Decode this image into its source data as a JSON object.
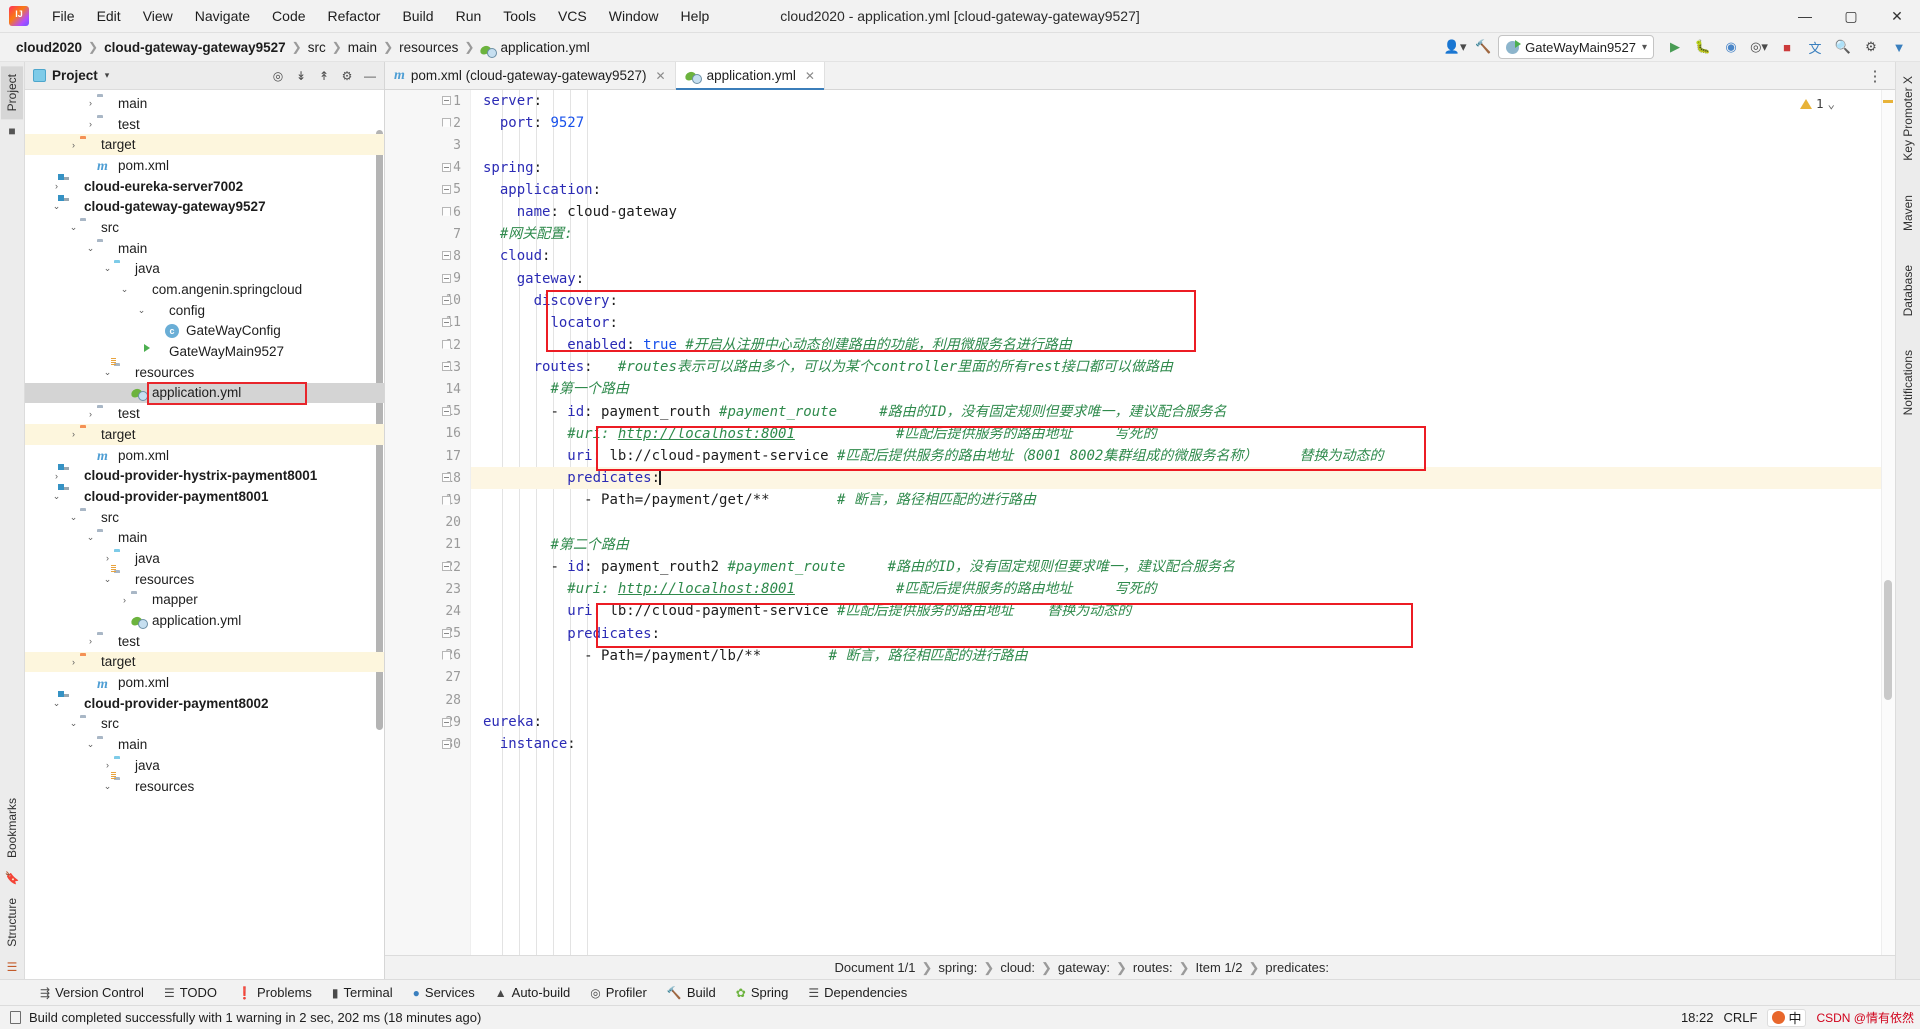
{
  "titlebar": {
    "logo_icon": "intellij-idea-logo",
    "menus": [
      "File",
      "Edit",
      "View",
      "Navigate",
      "Code",
      "Refactor",
      "Build",
      "Run",
      "Tools",
      "VCS",
      "Window",
      "Help"
    ],
    "window_title": "cloud2020 - application.yml [cloud-gateway-gateway9527]",
    "minimize": "—",
    "maximize": "▢",
    "close": "✕"
  },
  "navbar": {
    "crumbs": [
      {
        "label": "cloud2020",
        "bold": true
      },
      {
        "label": "cloud-gateway-gateway9527",
        "bold": true
      },
      {
        "label": "src",
        "bold": false
      },
      {
        "label": "main",
        "bold": false
      },
      {
        "label": "resources",
        "bold": false
      },
      {
        "label": "application.yml",
        "bold": false,
        "icon": "yml-file-icon"
      }
    ],
    "separator": "❯",
    "run_config": "GateWayMain9527",
    "run_config_caret": "▾",
    "icons": [
      "user-avatar-icon",
      "hammer-build-icon",
      "run-icon",
      "debug-icon",
      "coverage-icon",
      "profiler-icon",
      "stop-icon",
      "translate-icon",
      "search-icon",
      "settings-gear-icon",
      "updates-icon"
    ]
  },
  "left_rail": {
    "tabs": [
      "Project"
    ],
    "bottom_tabs": [
      "Bookmarks",
      "Structure"
    ]
  },
  "right_rail": {
    "tabs": [
      "Key Promoter X",
      "Maven",
      "Database",
      "Notifications"
    ]
  },
  "project_panel": {
    "title": "Project",
    "caret": "▾",
    "header_icons": [
      "locate-file-icon",
      "expand-all-icon",
      "collapse-all-icon",
      "settings-gear-icon",
      "hide-icon"
    ],
    "tree": [
      {
        "depth": 3,
        "arrow": "›",
        "icon": "folder-icon",
        "label": "main",
        "bold": false,
        "hl": ""
      },
      {
        "depth": 3,
        "arrow": "›",
        "icon": "folder-icon",
        "label": "test",
        "bold": false,
        "hl": ""
      },
      {
        "depth": 2,
        "arrow": "›",
        "icon": "folder-orange-icon",
        "label": "target",
        "bold": false,
        "hl": "yellow"
      },
      {
        "depth": 3,
        "arrow": "",
        "icon": "maven-pom-icon",
        "label": "pom.xml",
        "bold": false,
        "hl": ""
      },
      {
        "depth": 1,
        "arrow": "›",
        "icon": "module-icon",
        "label": "cloud-eureka-server7002",
        "bold": true,
        "hl": ""
      },
      {
        "depth": 1,
        "arrow": "⌄",
        "icon": "module-icon",
        "label": "cloud-gateway-gateway9527",
        "bold": true,
        "hl": ""
      },
      {
        "depth": 2,
        "arrow": "⌄",
        "icon": "folder-icon",
        "label": "src",
        "bold": false,
        "hl": ""
      },
      {
        "depth": 3,
        "arrow": "⌄",
        "icon": "folder-icon",
        "label": "main",
        "bold": false,
        "hl": ""
      },
      {
        "depth": 4,
        "arrow": "⌄",
        "icon": "folder-blue-icon",
        "label": "java",
        "bold": false,
        "hl": ""
      },
      {
        "depth": 5,
        "arrow": "⌄",
        "icon": "package-icon",
        "label": "com.angenin.springcloud",
        "bold": false,
        "hl": ""
      },
      {
        "depth": 6,
        "arrow": "⌄",
        "icon": "package-icon",
        "label": "config",
        "bold": false,
        "hl": ""
      },
      {
        "depth": 7,
        "arrow": "",
        "icon": "java-class-icon",
        "label": "GateWayConfig",
        "bold": false,
        "hl": ""
      },
      {
        "depth": 6,
        "arrow": "",
        "icon": "spring-main-class-icon",
        "label": "GateWayMain9527",
        "bold": false,
        "hl": ""
      },
      {
        "depth": 4,
        "arrow": "⌄",
        "icon": "resources-folder-icon",
        "label": "resources",
        "bold": false,
        "hl": ""
      },
      {
        "depth": 5,
        "arrow": "",
        "icon": "yml-file-icon",
        "label": "application.yml",
        "bold": false,
        "hl": "grey",
        "outlined": true
      },
      {
        "depth": 3,
        "arrow": "›",
        "icon": "folder-icon",
        "label": "test",
        "bold": false,
        "hl": ""
      },
      {
        "depth": 2,
        "arrow": "›",
        "icon": "folder-orange-icon",
        "label": "target",
        "bold": false,
        "hl": "yellow"
      },
      {
        "depth": 3,
        "arrow": "",
        "icon": "maven-pom-icon",
        "label": "pom.xml",
        "bold": false,
        "hl": ""
      },
      {
        "depth": 1,
        "arrow": "›",
        "icon": "module-icon",
        "label": "cloud-provider-hystrix-payment8001",
        "bold": true,
        "hl": ""
      },
      {
        "depth": 1,
        "arrow": "⌄",
        "icon": "module-icon",
        "label": "cloud-provider-payment8001",
        "bold": true,
        "hl": ""
      },
      {
        "depth": 2,
        "arrow": "⌄",
        "icon": "folder-icon",
        "label": "src",
        "bold": false,
        "hl": ""
      },
      {
        "depth": 3,
        "arrow": "⌄",
        "icon": "folder-icon",
        "label": "main",
        "bold": false,
        "hl": ""
      },
      {
        "depth": 4,
        "arrow": "›",
        "icon": "folder-blue-icon",
        "label": "java",
        "bold": false,
        "hl": ""
      },
      {
        "depth": 4,
        "arrow": "⌄",
        "icon": "resources-folder-icon",
        "label": "resources",
        "bold": false,
        "hl": ""
      },
      {
        "depth": 5,
        "arrow": "›",
        "icon": "folder-icon",
        "label": "mapper",
        "bold": false,
        "hl": ""
      },
      {
        "depth": 5,
        "arrow": "",
        "icon": "yml-file-icon",
        "label": "application.yml",
        "bold": false,
        "hl": ""
      },
      {
        "depth": 3,
        "arrow": "›",
        "icon": "folder-icon",
        "label": "test",
        "bold": false,
        "hl": ""
      },
      {
        "depth": 2,
        "arrow": "›",
        "icon": "folder-orange-icon",
        "label": "target",
        "bold": false,
        "hl": "yellow"
      },
      {
        "depth": 3,
        "arrow": "",
        "icon": "maven-pom-icon",
        "label": "pom.xml",
        "bold": false,
        "hl": ""
      },
      {
        "depth": 1,
        "arrow": "⌄",
        "icon": "module-icon",
        "label": "cloud-provider-payment8002",
        "bold": true,
        "hl": ""
      },
      {
        "depth": 2,
        "arrow": "⌄",
        "icon": "folder-icon",
        "label": "src",
        "bold": false,
        "hl": ""
      },
      {
        "depth": 3,
        "arrow": "⌄",
        "icon": "folder-icon",
        "label": "main",
        "bold": false,
        "hl": ""
      },
      {
        "depth": 4,
        "arrow": "›",
        "icon": "folder-blue-icon",
        "label": "java",
        "bold": false,
        "hl": ""
      },
      {
        "depth": 4,
        "arrow": "⌄",
        "icon": "resources-folder-icon",
        "label": "resources",
        "bold": false,
        "hl": ""
      }
    ]
  },
  "editor": {
    "tabs": [
      {
        "label": "pom.xml (cloud-gateway-gateway9527)",
        "icon": "maven-pom-icon",
        "active": false,
        "close": "✕"
      },
      {
        "label": "application.yml",
        "icon": "yml-file-icon",
        "active": true,
        "close": "✕"
      }
    ],
    "warning_count": "1",
    "warning_icon": "warning-triangle-icon",
    "inspection_caret": "⌄",
    "more_icon": "⋮",
    "lines": [
      {
        "n": 1,
        "fold": "open",
        "html": "<span class='k'>server</span><span class='s'>:</span>"
      },
      {
        "n": 2,
        "fold": "end",
        "html": "  <span class='k'>port</span><span class='s'>: </span><span class='n'>9527</span>"
      },
      {
        "n": 3,
        "fold": "",
        "html": ""
      },
      {
        "n": 4,
        "fold": "open",
        "html": "<span class='k'>spring</span><span class='s'>:</span>"
      },
      {
        "n": 5,
        "fold": "open",
        "html": "  <span class='k'>application</span><span class='s'>:</span>"
      },
      {
        "n": 6,
        "fold": "end",
        "html": "    <span class='k'>name</span><span class='s'>: cloud-gateway</span>"
      },
      {
        "n": 7,
        "fold": "",
        "html": "  <span class='cm'>#网关配置:</span>"
      },
      {
        "n": 8,
        "fold": "open",
        "html": "  <span class='k'>cloud</span><span class='s'>:</span>"
      },
      {
        "n": 9,
        "fold": "open",
        "html": "    <span class='k'>gateway</span><span class='s'>:</span>"
      },
      {
        "n": 10,
        "fold": "open",
        "html": "      <span class='k'>discovery</span><span class='s'>:</span>"
      },
      {
        "n": 11,
        "fold": "open",
        "html": "        <span class='k'>locator</span><span class='s'>:</span>"
      },
      {
        "n": 12,
        "fold": "end",
        "html": "          <span class='k'>enabled</span><span class='s'>: </span><span class='n'>true</span> <span class='cm'>#开启从注册中心动态创建路由的功能，利用微服务名进行路由</span>"
      },
      {
        "n": 13,
        "fold": "open",
        "html": "      <span class='k'>routes</span><span class='s'>:</span>   <span class='cm'>#routes表示可以路由多个，可以为某个controller里面的所有rest接口都可以做路由</span>"
      },
      {
        "n": 14,
        "fold": "",
        "html": "        <span class='cm'>#第一个路由</span>"
      },
      {
        "n": 15,
        "fold": "open",
        "html": "        <span class='s'>- </span><span class='k'>id</span><span class='s'>: payment_routh </span><span class='cm'>#payment_route</span>     <span class='cm'>#路由的ID，没有固定规则但要求唯一，建议配合服务名</span>"
      },
      {
        "n": 16,
        "fold": "",
        "html": "          <span class='cm'>#uri: </span><span class='cmlink'>http://localhost:8001</span>            <span class='cm'>#匹配后提供服务的路由地址     写死的</span>"
      },
      {
        "n": 17,
        "fold": "",
        "html": "          <span class='k'>uri</span><span class='s'>: lb://cloud-payment-service</span> <span class='cm'>#匹配后提供服务的路由地址（8001 8002集群组成的微服务名称）     替换为动态的</span>"
      },
      {
        "n": 18,
        "fold": "open",
        "cur": true,
        "html": "          <span class='k'>predicates</span><span class='s'>:</span><span class='caret'></span>"
      },
      {
        "n": 19,
        "fold": "end",
        "html": "            <span class='s'>- Path=/payment/get/**</span>        <span class='cm'># 断言，路径相匹配的进行路由</span>"
      },
      {
        "n": 20,
        "fold": "",
        "html": ""
      },
      {
        "n": 21,
        "fold": "",
        "html": "        <span class='cm'>#第二个路由</span>"
      },
      {
        "n": 22,
        "fold": "open",
        "html": "        <span class='s'>- </span><span class='k'>id</span><span class='s'>: payment_routh2 </span><span class='cm'>#payment_route</span>     <span class='cm'>#路由的ID，没有固定规则但要求唯一，建议配合服务名</span>"
      },
      {
        "n": 23,
        "fold": "",
        "html": "          <span class='cm'>#uri: </span><span class='cmlink'>http://localhost:8001</span>            <span class='cm'>#匹配后提供服务的路由地址     写死的</span>"
      },
      {
        "n": 24,
        "fold": "",
        "html": "          <span class='k'>uri</span><span class='s'>: lb://cloud-payment-service</span> <span class='cm'>#匹配后提供服务的路由地址    替换为动态的</span>"
      },
      {
        "n": 25,
        "fold": "open",
        "html": "          <span class='k'>predicates</span><span class='s'>:</span>"
      },
      {
        "n": 26,
        "fold": "end",
        "html": "            <span class='s'>- Path=/payment/lb/**</span>        <span class='cm'># 断言，路径相匹配的进行路由</span>"
      },
      {
        "n": 27,
        "fold": "",
        "html": ""
      },
      {
        "n": 28,
        "fold": "",
        "html": ""
      },
      {
        "n": 29,
        "fold": "open",
        "html": "<span class='k'>eureka</span><span class='s'>:</span>"
      },
      {
        "n": 30,
        "fold": "open",
        "html": "  <span class='k'>instance</span><span class='s'>:</span>"
      }
    ],
    "breadcrumbs": [
      "Document 1/1",
      "spring:",
      "cloud:",
      "gateway:",
      "routes:",
      "Item 1/2",
      "predicates:"
    ],
    "breadcrumb_sep": "❯"
  },
  "bottom_toolwindows": [
    {
      "label": "Version Control",
      "icon": "branch-icon"
    },
    {
      "label": "TODO",
      "icon": "list-icon"
    },
    {
      "label": "Problems",
      "icon": "error-circle-icon"
    },
    {
      "label": "Terminal",
      "icon": "terminal-icon"
    },
    {
      "label": "Services",
      "icon": "services-icon"
    },
    {
      "label": "Auto-build",
      "icon": "warning-triangle-icon"
    },
    {
      "label": "Profiler",
      "icon": "profiler-icon"
    },
    {
      "label": "Build",
      "icon": "hammer-build-icon"
    },
    {
      "label": "Spring",
      "icon": "spring-leaf-icon"
    },
    {
      "label": "Dependencies",
      "icon": "layers-icon"
    }
  ],
  "statusbar": {
    "icon": "build-status-icon",
    "message": "Build completed successfully with 1 warning in 2 sec, 202 ms (18 minutes ago)",
    "time": "18:22",
    "line_sep": "CRLF",
    "ime_label": "中",
    "watermark": "情有依然",
    "csdn": "CSDN @情有依然"
  },
  "colors": {
    "accent": "#3b7eba",
    "red_highlight": "#ec1c24",
    "comment_green": "#2f8a4c",
    "key_blue": "#2b2bb5",
    "number_blue": "#1750eb",
    "highlight_yellow": "#fdf6dd"
  }
}
